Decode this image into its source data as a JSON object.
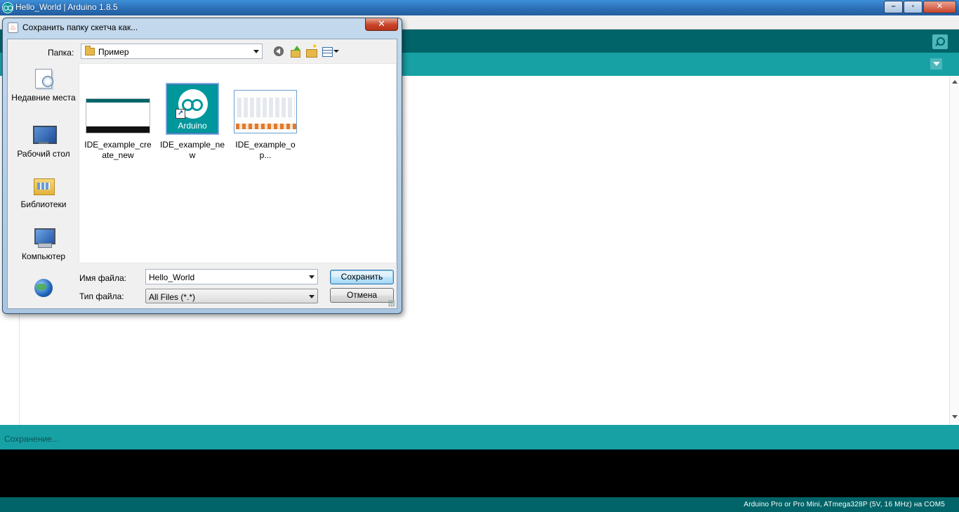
{
  "window": {
    "title": "Hello_World | Arduino 1.8.5",
    "controls": {
      "minimize": "–",
      "maximize": "▫",
      "close": "✕"
    }
  },
  "status": {
    "message": "Сохранение..."
  },
  "footer": {
    "board_info": "Arduino Pro or Pro Mini, ATmega328P (5V, 16 MHz) на COM5"
  },
  "dialog": {
    "title": "Сохранить папку скетча как...",
    "close_label": "✕",
    "look_in_label": "Папка:",
    "look_in_value": "Пример",
    "places": [
      {
        "label": "Недавние места",
        "icon": "recent-places-icon"
      },
      {
        "label": "Рабочий стол",
        "icon": "desktop-icon"
      },
      {
        "label": "Библиотеки",
        "icon": "libraries-icon"
      },
      {
        "label": "Компьютер",
        "icon": "computer-icon"
      },
      {
        "label": "",
        "icon": "network-icon"
      }
    ],
    "files": [
      {
        "name": "IDE_example_create_new",
        "selected": false
      },
      {
        "name": "IDE_example_new",
        "selected": true,
        "thumb_label": "Arduino"
      },
      {
        "name": "IDE_example_op...",
        "selected": false
      }
    ],
    "file_name_label": "Имя файла:",
    "file_name_value": "Hello_World",
    "file_type_label": "Тип файла:",
    "file_type_value": "All Files (*.*)",
    "save_button": "Сохранить",
    "cancel_button": "Отмена"
  },
  "colors": {
    "toolbar": "#006468",
    "tabbar": "#17a1a5",
    "console": "#000000",
    "accent": "#00979c"
  }
}
